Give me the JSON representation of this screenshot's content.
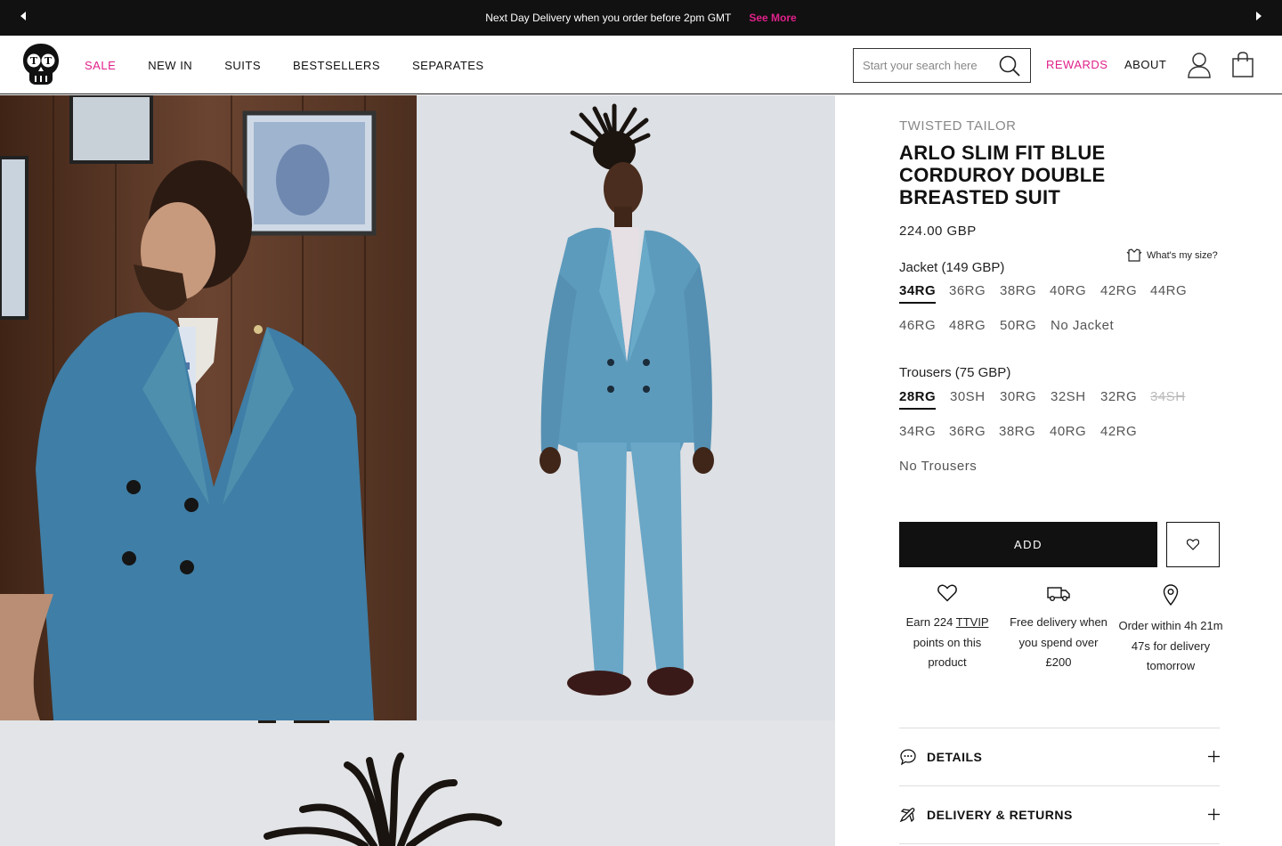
{
  "announcement": {
    "text": "Next Day Delivery when you order before 2pm GMT",
    "link": "See More"
  },
  "header": {
    "nav": [
      "SALE",
      "NEW IN",
      "SUITS",
      "BESTSELLERS",
      "SEPARATES"
    ],
    "search_placeholder": "Start your search here",
    "rewards": "REWARDS",
    "about": "ABOUT"
  },
  "product": {
    "brand": "TWISTED TAILOR",
    "title": "ARLO SLIM FIT BLUE CORDUROY DOUBLE BREASTED SUIT",
    "price": "224.00 GBP",
    "size_guide": "What's my size?",
    "jacket": {
      "label": "Jacket (149 GBP)",
      "selected": "34RG",
      "sizes": [
        "34RG",
        "36RG",
        "38RG",
        "40RG",
        "42RG",
        "44RG",
        "46RG",
        "48RG",
        "50RG",
        "No Jacket"
      ]
    },
    "trousers": {
      "label": "Trousers (75 GBP)",
      "selected": "28RG",
      "unavailable": [
        "34SH"
      ],
      "sizes": [
        "28RG",
        "30SH",
        "30RG",
        "32SH",
        "32RG",
        "34SH",
        "34RG",
        "36RG",
        "38RG",
        "40RG",
        "42RG",
        "No Trousers"
      ]
    },
    "add_label": "ADD"
  },
  "features": {
    "points_pre": "Earn 224",
    "points_link": "TTVIP",
    "points_post": "points on this product",
    "delivery": "Free delivery when you spend over £200",
    "order_within": "Order within 4h 21m 47s for delivery tomorrow"
  },
  "accordions": {
    "details": "DETAILS",
    "delivery_returns": "DELIVERY & RETURNS"
  },
  "colors": {
    "accent_pink": "#e0218a",
    "dark": "#111111",
    "suit_blue": "#4f8fae"
  },
  "icons": {
    "logo": "skull-logo",
    "search": "search-icon",
    "account": "user-icon",
    "bag": "shopping-bag-icon",
    "wishlist": "heart-icon",
    "truck": "truck-icon",
    "location": "map-pin-icon",
    "details": "chat-icon",
    "delivery": "plane-icon",
    "expand": "plus-icon"
  }
}
